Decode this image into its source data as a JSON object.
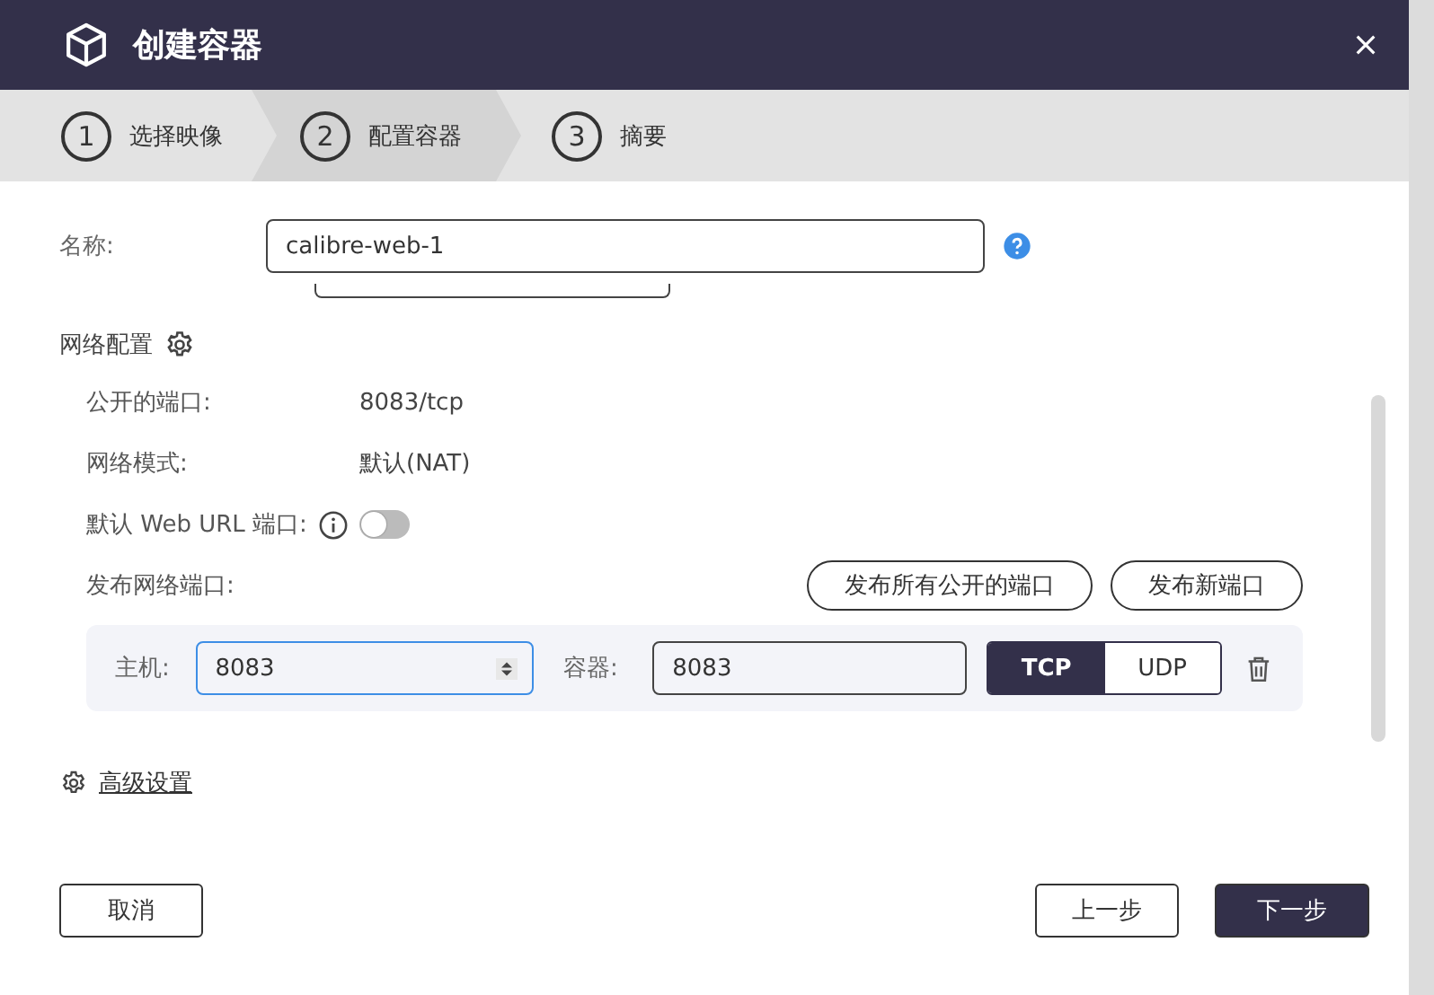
{
  "window": {
    "title": "创建容器"
  },
  "steps": [
    {
      "number": "1",
      "label": "选择映像",
      "selected": false
    },
    {
      "number": "2",
      "label": "配置容器",
      "selected": true
    },
    {
      "number": "3",
      "label": "摘要",
      "selected": false
    }
  ],
  "name_field": {
    "label": "名称:",
    "value": "calibre-web-1"
  },
  "network": {
    "title": "网络配置",
    "rows": [
      {
        "kind": "text",
        "label": "公开的端口:",
        "value": "8083/tcp"
      },
      {
        "kind": "text",
        "label": "网络模式:",
        "value": "默认(NAT)"
      },
      {
        "kind": "toggle",
        "label": "默认 Web URL 端口:",
        "on": false
      }
    ],
    "publish": {
      "label": "发布网络端口:",
      "buttons": [
        "发布所有公开的端口",
        "发布新端口"
      ]
    },
    "ports": [
      {
        "host_label": "主机:",
        "host": "8083",
        "container_label": "容器:",
        "container": "8083",
        "protocols": [
          {
            "label": "TCP",
            "selected": true
          },
          {
            "label": "UDP",
            "selected": false
          }
        ]
      }
    ]
  },
  "advanced_link": "高级设置",
  "footer": {
    "cancel": "取消",
    "back": "上一步",
    "next": "下一步"
  }
}
